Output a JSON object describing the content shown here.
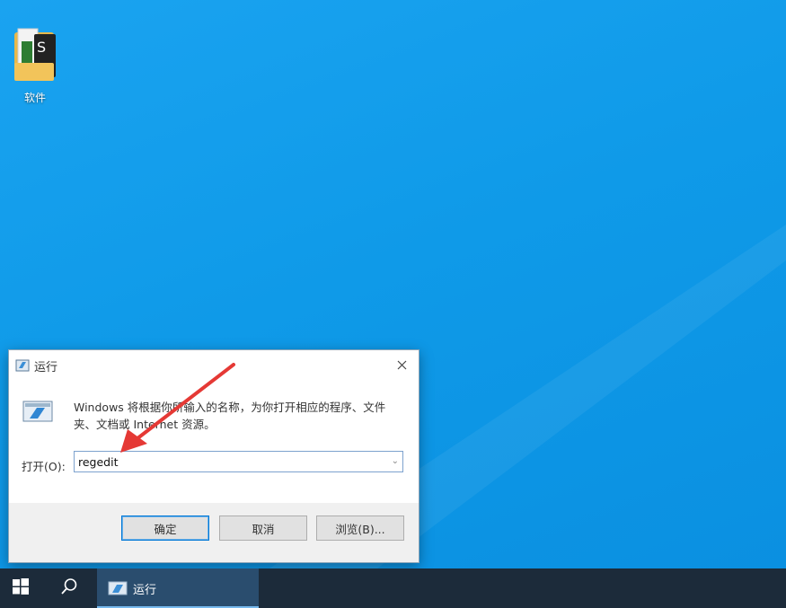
{
  "desktop": {
    "icons": [
      {
        "label": "软件",
        "icon": "folder-icon"
      }
    ]
  },
  "run_dialog": {
    "title": "运行",
    "description": "Windows 将根据你所输入的名称，为你打开相应的程序、文件夹、文档或 Internet 资源。",
    "open_label": "打开(O):",
    "input_value": "regedit",
    "buttons": {
      "ok": "确定",
      "cancel": "取消",
      "browse": "浏览(B)..."
    }
  },
  "taskbar": {
    "running_app_label": "运行"
  },
  "colors": {
    "desktop_blue": "#0f9ae8",
    "taskbar": "#1c2b3a",
    "annotation_arrow": "#e53935"
  }
}
